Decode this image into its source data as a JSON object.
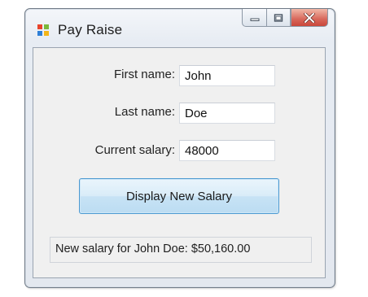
{
  "window": {
    "title": "Pay Raise",
    "icon": "windows-forms-app-icon"
  },
  "caption_buttons": {
    "minimize_icon": "minimize-icon",
    "maximize_icon": "maximize-icon",
    "close_icon": "close-icon",
    "close_color": "#d35a4c"
  },
  "form": {
    "first_name": {
      "label": "First name:",
      "value": "John"
    },
    "last_name": {
      "label": "Last name:",
      "value": "Doe"
    },
    "current_salary": {
      "label": "Current salary:",
      "value": "48000"
    },
    "display_button_label": "Display New Salary",
    "button_accent": "#4d9ad1",
    "result_text": "New salary for John Doe: $50,160.00"
  }
}
